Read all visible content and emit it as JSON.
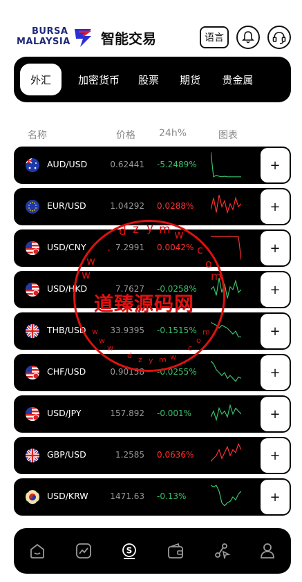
{
  "header": {
    "logo_line1": "BURSA",
    "logo_line2": "MALAYSIA",
    "title": "智能交易",
    "lang_label": "语言",
    "bell_icon": "bell-icon",
    "support_icon": "headset-icon"
  },
  "tabs": [
    {
      "label": "外汇",
      "active": true
    },
    {
      "label": "加密货币",
      "active": false
    },
    {
      "label": "股票",
      "active": false
    },
    {
      "label": "期货",
      "active": false
    },
    {
      "label": "贵金属",
      "active": false
    }
  ],
  "columns": {
    "name": "名称",
    "price": "价格",
    "change": "24h%",
    "chart": "图表"
  },
  "rows": [
    {
      "pair": "AUD/USD",
      "price": "0.62441",
      "change": "-5.2489%",
      "trend": "up",
      "flag": "au-flag-icon",
      "spark": [
        0.95,
        0.1,
        0.15,
        0.12,
        0.1,
        0.12,
        0.1,
        0.1,
        0.1,
        0.1,
        0.1,
        0.1
      ]
    },
    {
      "pair": "EUR/USD",
      "price": "1.04292",
      "change": "0.0288%",
      "trend": "down",
      "flag": "eu-flag-icon",
      "spark": [
        0.4,
        0.8,
        0.3,
        0.9,
        0.5,
        0.7,
        0.3,
        0.6,
        0.4,
        0.8,
        0.5,
        0.6
      ]
    },
    {
      "pair": "USD/CNY",
      "price": "7.2991",
      "change": "0.0042%",
      "trend": "down",
      "flag": "us-flag-icon",
      "spark": [
        0.9,
        0.9,
        0.9,
        0.9,
        0.9,
        0.9,
        0.9,
        0.9,
        0.9,
        0.9,
        0.9,
        0.1
      ]
    },
    {
      "pair": "USD/HKD",
      "price": "7.7627",
      "change": "-0.0258%",
      "trend": "up",
      "flag": "us-flag-icon",
      "spark": [
        0.5,
        0.6,
        0.3,
        0.9,
        0.4,
        0.7,
        0.2,
        0.6,
        0.5,
        0.8,
        0.4,
        0.5
      ]
    },
    {
      "pair": "THB/USD",
      "price": "33.9395",
      "change": "-0.1515%",
      "trend": "up",
      "flag": "uk-flag-icon",
      "spark": [
        0.8,
        0.75,
        0.7,
        0.6,
        0.7,
        0.65,
        0.6,
        0.5,
        0.4,
        0.5,
        0.3,
        0.3
      ]
    },
    {
      "pair": "CHF/USD",
      "price": "0.90158",
      "change": "-0.0255%",
      "trend": "up",
      "flag": "us-flag-icon",
      "spark": [
        0.9,
        0.8,
        0.6,
        0.5,
        0.4,
        0.5,
        0.3,
        0.4,
        0.3,
        0.2,
        0.35,
        0.3
      ]
    },
    {
      "pair": "USD/JPY",
      "price": "157.892",
      "change": "-0.001%",
      "trend": "up",
      "flag": "us-flag-icon",
      "spark": [
        0.4,
        0.6,
        0.3,
        0.7,
        0.5,
        0.6,
        0.4,
        0.8,
        0.5,
        0.7,
        0.6,
        0.5
      ]
    },
    {
      "pair": "GBP/USD",
      "price": "1.2585",
      "change": "0.0636%",
      "trend": "down",
      "flag": "uk-flag-icon",
      "spark": [
        0.3,
        0.4,
        0.5,
        0.7,
        0.4,
        0.6,
        0.8,
        0.5,
        0.7,
        0.6,
        0.9,
        0.7
      ]
    },
    {
      "pair": "USD/KRW",
      "price": "1471.63",
      "change": "-0.13%",
      "trend": "up",
      "flag": "kr-flag-icon",
      "spark": [
        0.9,
        0.85,
        0.9,
        0.7,
        0.3,
        0.2,
        0.3,
        0.35,
        0.5,
        0.4,
        0.6,
        0.7
      ]
    }
  ],
  "add_label": "+",
  "bottom_nav": [
    {
      "icon": "home-icon"
    },
    {
      "icon": "chart-icon"
    },
    {
      "icon": "trade-icon",
      "active": true
    },
    {
      "icon": "wallet-icon"
    },
    {
      "icon": "share-icon"
    },
    {
      "icon": "profile-icon"
    }
  ],
  "watermark": {
    "text": "道臻源码网",
    "ring_top": "dzym",
    "ring_left": "ww",
    "ring_right": "com",
    "inner_bottom": "wwdzym.co",
    "inner_small": "m"
  },
  "colors": {
    "up": "#39c26a",
    "down": "#ff3030",
    "accent": "#000000",
    "watermark": "#e01010"
  }
}
